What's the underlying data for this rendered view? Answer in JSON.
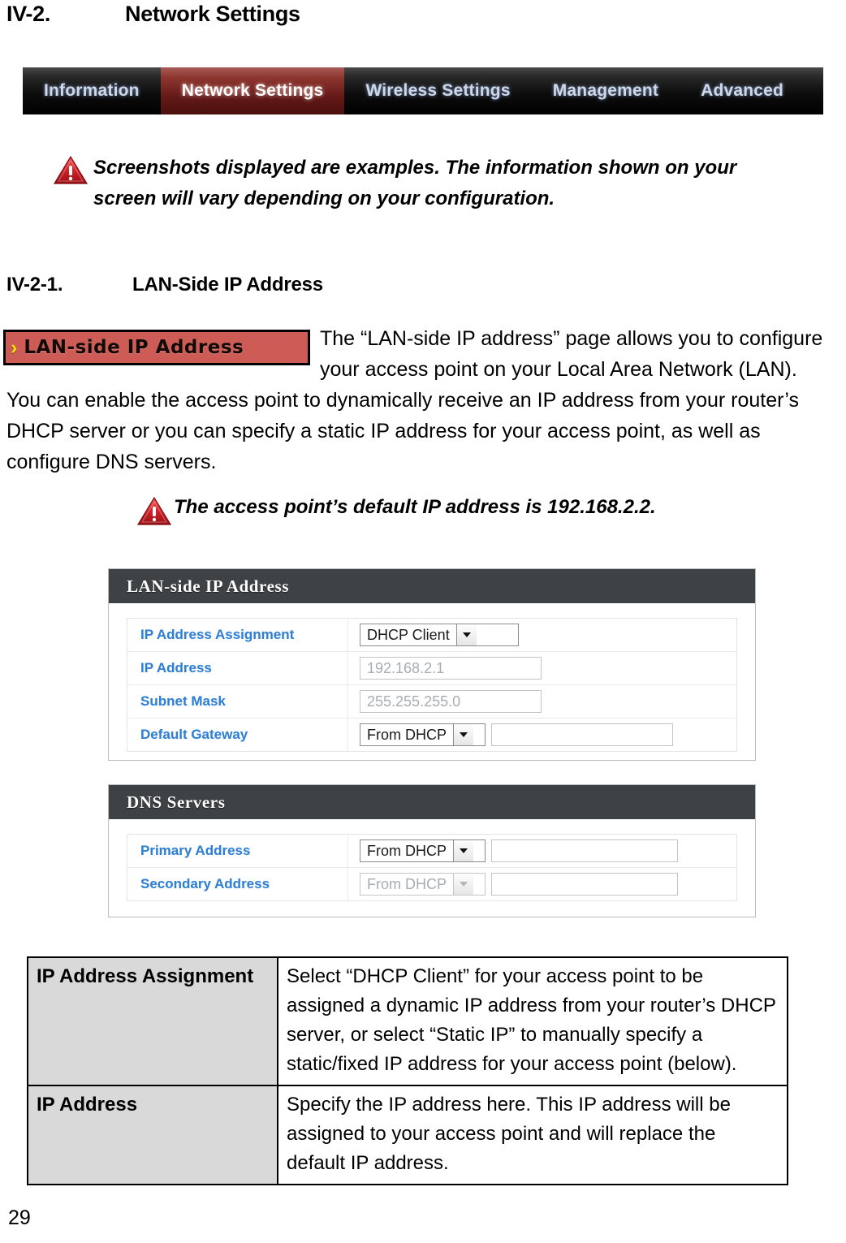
{
  "headings": {
    "section_number": "IV-2.",
    "section_title": "Network Settings",
    "subsection_number": "IV-2-1.",
    "subsection_title": "LAN-Side IP Address"
  },
  "navbar": {
    "tabs": [
      {
        "label": "Information",
        "active": false
      },
      {
        "label": "Network Settings",
        "active": true
      },
      {
        "label": "Wireless Settings",
        "active": false
      },
      {
        "label": "Management",
        "active": false
      },
      {
        "label": "Advanced",
        "active": false
      }
    ],
    "active_tab_color": "#8e3630",
    "background_color": "#000000"
  },
  "notes": {
    "note_1": "Screenshots displayed are examples. The information shown on your screen will vary depending on your configuration.",
    "note_2": "The access point’s default IP address is 192.168.2.2.",
    "icon": "warning-triangle-icon",
    "icon_color": "#d0282e"
  },
  "callout": {
    "chevron": "›",
    "label": "LAN-side IP Address",
    "background_color": "#ce5c56",
    "chevron_color": "#f4e200"
  },
  "body_paragraph": "The “LAN-side IP address” page allows you to configure your access point on your Local Area Network (LAN). You can enable the access point to dynamically receive an IP address from your router’s DHCP server or you can specify a static IP address for your access point, as well as configure DNS servers.",
  "panels": [
    {
      "title": "LAN-side IP Address",
      "rows": [
        {
          "label": "IP Address Assignment",
          "control": "select",
          "value": "DHCP Client",
          "disabled": false
        },
        {
          "label": "IP Address",
          "control": "input",
          "value": "192.168.2.1",
          "disabled": false
        },
        {
          "label": "Subnet Mask",
          "control": "input",
          "value": "255.255.255.0",
          "disabled": false
        },
        {
          "label": "Default Gateway",
          "control": "select-input",
          "value": "From DHCP",
          "text_value": "",
          "disabled": false
        }
      ]
    },
    {
      "title": "DNS Servers",
      "rows": [
        {
          "label": "Primary Address",
          "control": "select-input",
          "value": "From DHCP",
          "text_value": "",
          "disabled": false
        },
        {
          "label": "Secondary Address",
          "control": "select-input",
          "value": "From DHCP",
          "text_value": "",
          "disabled": true
        }
      ]
    }
  ],
  "description_table": {
    "rows": [
      {
        "key": "IP Address Assignment",
        "value": "Select “DHCP Client” for your access point to be assigned a dynamic IP address from your router’s DHCP server, or select “Static IP” to manually specify a static/fixed IP address for your access point (below)."
      },
      {
        "key": "IP Address",
        "value": "Specify the IP address here. This IP address will be assigned to your access point and will replace the default IP address."
      }
    ]
  },
  "footer": {
    "page_number": "29"
  }
}
